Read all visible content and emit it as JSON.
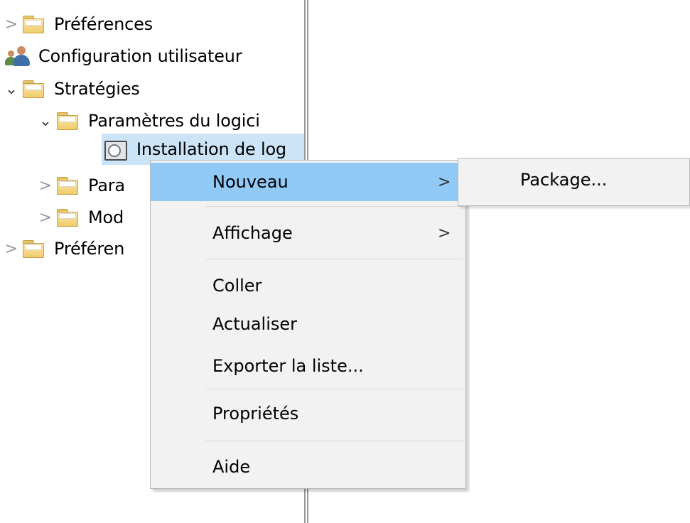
{
  "tree": {
    "items": [
      {
        "label": "Préférences",
        "chevron": ">"
      },
      {
        "label": "Configuration utilisateur"
      },
      {
        "label": "Stratégies",
        "chevron": "v"
      },
      {
        "label": "Paramètres du logici",
        "chevron": "v"
      },
      {
        "label": "Installation de log"
      },
      {
        "label": "Para",
        "chevron": ">"
      },
      {
        "label": "Mod",
        "chevron": ">"
      },
      {
        "label": "Préféren",
        "chevron": ">"
      }
    ]
  },
  "context_menu": {
    "items": [
      {
        "label": "Nouveau",
        "arrow": ">",
        "highlighted": true
      },
      {
        "label": "Affichage",
        "arrow": ">"
      },
      {
        "label": "Coller"
      },
      {
        "label": "Actualiser"
      },
      {
        "label": "Exporter la liste..."
      },
      {
        "label": "Propriétés"
      },
      {
        "label": "Aide"
      }
    ]
  },
  "submenu": {
    "items": [
      {
        "label": "Package..."
      }
    ]
  },
  "colors": {
    "highlight": "#91c9f7",
    "selection": "#cce4f7",
    "menu_bg": "#f2f2f2"
  }
}
